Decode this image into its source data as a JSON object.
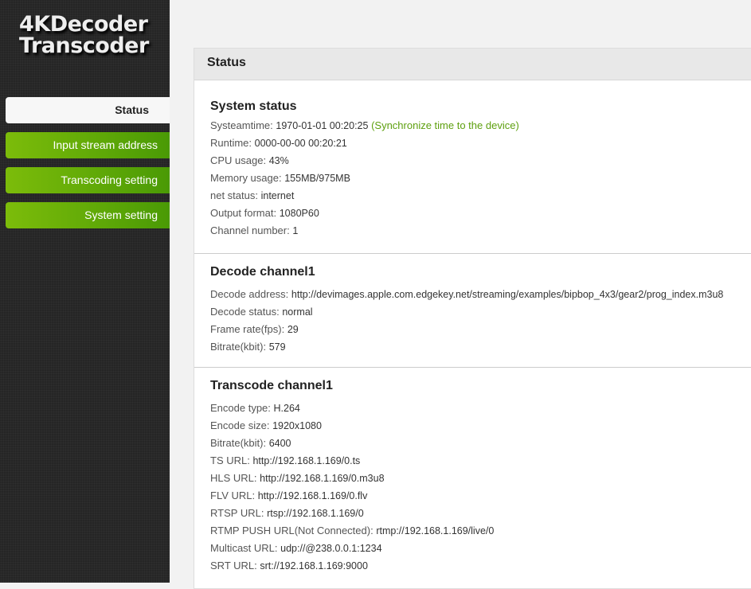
{
  "logo": {
    "line1": "4KDecoder",
    "line2": "Transcoder"
  },
  "nav": [
    "Status",
    "Input stream address",
    "Transcoding setting",
    "System setting"
  ],
  "panel_title": "Status",
  "system": {
    "title": "System status",
    "sync_link": "(Synchronize time to the device)",
    "rows": [
      {
        "label": "Systeamtime:",
        "value": "1970-01-01 00:20:25"
      },
      {
        "label": "Runtime:",
        "value": "0000-00-00 00:20:21"
      },
      {
        "label": "CPU usage:",
        "value": "43%"
      },
      {
        "label": "Memory usage:",
        "value": "155MB/975MB"
      },
      {
        "label": "net status:",
        "value": "internet"
      },
      {
        "label": "Output format:",
        "value": "1080P60"
      },
      {
        "label": "Channel number:",
        "value": "1"
      }
    ]
  },
  "decode": {
    "title": "Decode channel1",
    "rows": [
      {
        "label": "Decode address:",
        "value": "http://devimages.apple.com.edgekey.net/streaming/examples/bipbop_4x3/gear2/prog_index.m3u8"
      },
      {
        "label": "Decode status:",
        "value": "normal"
      },
      {
        "label": "Frame rate(fps):",
        "value": "29"
      },
      {
        "label": "Bitrate(kbit):",
        "value": "579"
      }
    ]
  },
  "transcode": {
    "title": "Transcode channel1",
    "rows": [
      {
        "label": "Encode type:",
        "value": "H.264"
      },
      {
        "label": "Encode size:",
        "value": "1920x1080"
      },
      {
        "label": "Bitrate(kbit):",
        "value": "6400"
      },
      {
        "label": "TS URL:",
        "value": "http://192.168.1.169/0.ts"
      },
      {
        "label": "HLS URL:",
        "value": "http://192.168.1.169/0.m3u8"
      },
      {
        "label": "FLV URL:",
        "value": "http://192.168.1.169/0.flv"
      },
      {
        "label": "RTSP URL:",
        "value": "rtsp://192.168.1.169/0"
      },
      {
        "label": "RTMP PUSH URL(Not Connected):",
        "value": "rtmp://192.168.1.169/live/0"
      },
      {
        "label": "Multicast URL:",
        "value": "udp://@238.0.0.1:1234"
      },
      {
        "label": "SRT URL:",
        "value": "srt://192.168.1.169:9000"
      }
    ]
  }
}
